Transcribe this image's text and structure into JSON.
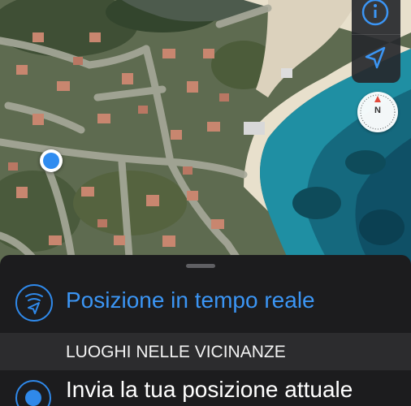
{
  "map": {
    "compass_letter": "N",
    "icons": {
      "info": "info-icon",
      "locate": "location-arrow-icon",
      "compass": "compass-icon",
      "user_location": "user-location-dot-icon"
    }
  },
  "sheet": {
    "live_location_label": "Posizione in tempo reale",
    "section_header": "LUOGHI NELLE VICINANZE",
    "send_current_location_label": "Invia la tua posizione attuale",
    "icons": {
      "live_location": "live-location-icon",
      "send_location": "current-location-icon"
    }
  },
  "colors": {
    "accent": "#3b95f4",
    "sheet_background": "#1c1c1e",
    "section_background": "#2c2c2e"
  }
}
